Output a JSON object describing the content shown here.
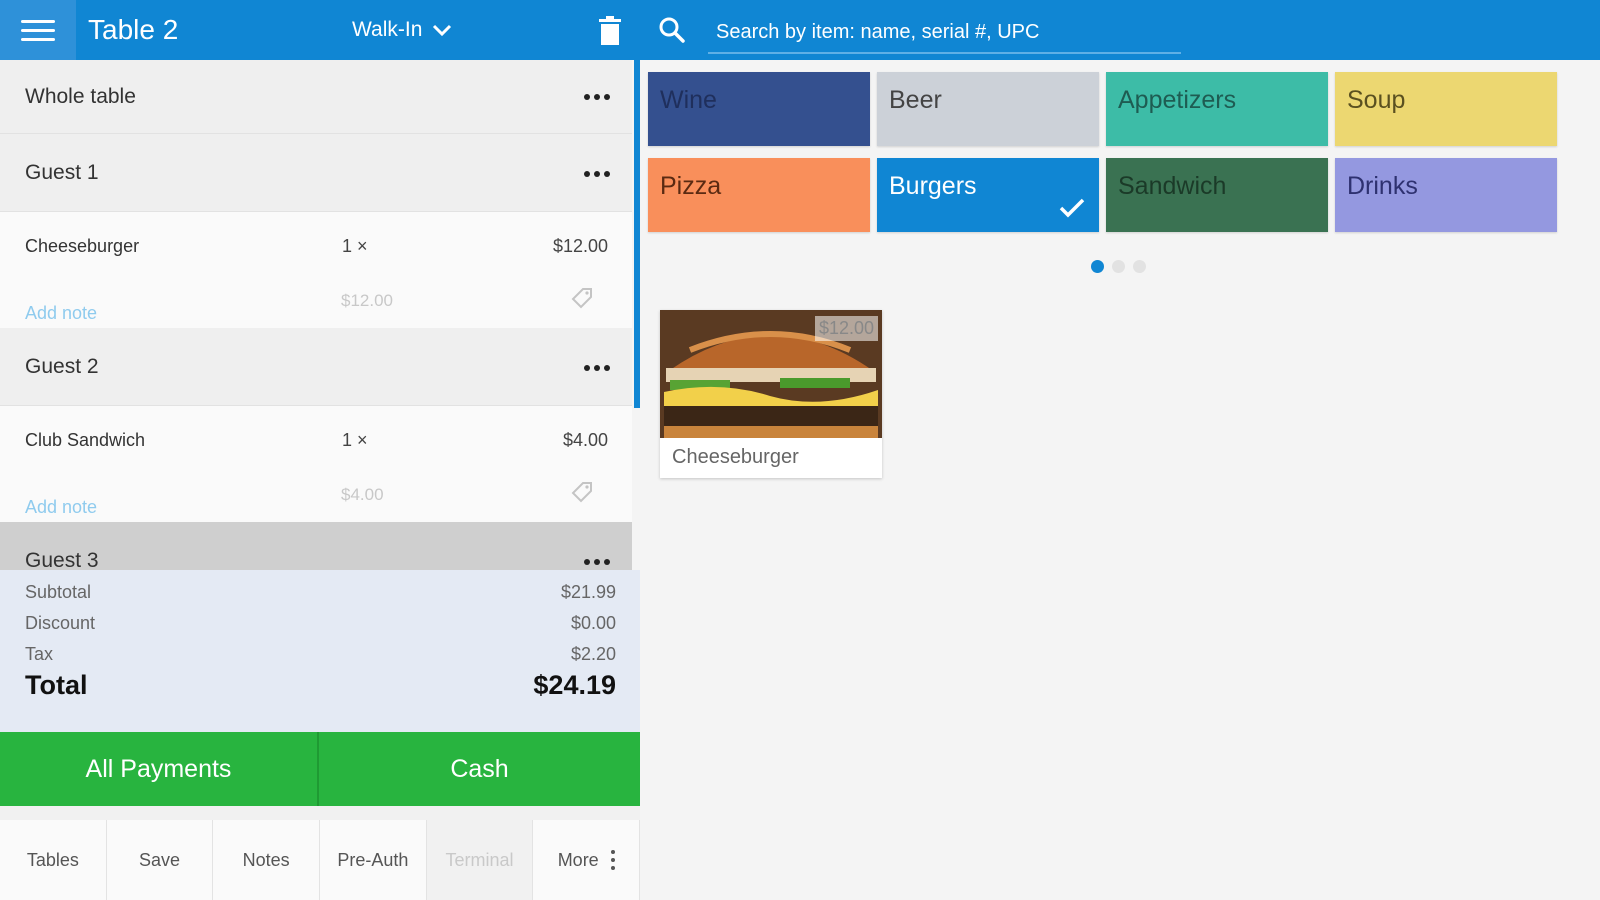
{
  "header": {
    "title": "Table 2",
    "order_type": "Walk-In"
  },
  "search": {
    "placeholder": "Search by item: name, serial #, UPC"
  },
  "order": {
    "whole_table": "Whole table",
    "guests": [
      {
        "label": "Guest 1",
        "items": [
          {
            "name": "Cheeseburger",
            "qty": "1 ×",
            "price": "$12.00",
            "subprice": "$12.00",
            "note_link": "Add note"
          }
        ]
      },
      {
        "label": "Guest 2",
        "items": [
          {
            "name": "Club Sandwich",
            "qty": "1 ×",
            "price": "$4.00",
            "subprice": "$4.00",
            "note_link": "Add note"
          }
        ]
      },
      {
        "label": "Guest 3",
        "items": []
      }
    ]
  },
  "totals": {
    "subtotal_label": "Subtotal",
    "subtotal": "$21.99",
    "discount_label": "Discount",
    "discount": "$0.00",
    "tax_label": "Tax",
    "tax": "$2.20",
    "total_label": "Total",
    "total": "$24.19"
  },
  "payments": {
    "all_label": "All Payments",
    "cash_label": "Cash",
    "color": "#28b43f"
  },
  "footer": {
    "tables": "Tables",
    "save": "Save",
    "notes": "Notes",
    "preauth": "Pre-Auth",
    "terminal": "Terminal",
    "more": "More"
  },
  "categories": [
    {
      "name": "Wine",
      "color": "#34508f",
      "text_color": "#1f2f5c"
    },
    {
      "name": "Beer",
      "color": "#ccd1d8",
      "text_color": "#444444"
    },
    {
      "name": "Appetizers",
      "color": "#3dbca7",
      "text_color": "#1e5c52"
    },
    {
      "name": "Soup",
      "color": "#ecd771",
      "text_color": "#5a5020"
    },
    {
      "name": "Pizza",
      "color": "#f98f5b",
      "text_color": "#5a2a12"
    },
    {
      "name": "Burgers",
      "color": "#1086d3",
      "text_color": "#ffffff",
      "selected": true
    },
    {
      "name": "Sandwich",
      "color": "#3a7252",
      "text_color": "#1b3a28"
    },
    {
      "name": "Drinks",
      "color": "#9498e0",
      "text_color": "#2e3170"
    }
  ],
  "pager": {
    "pages": 3,
    "current": 1
  },
  "products": [
    {
      "name": "Cheeseburger",
      "price": "$12.00"
    }
  ],
  "colors": {
    "accent": "#1086d3"
  }
}
